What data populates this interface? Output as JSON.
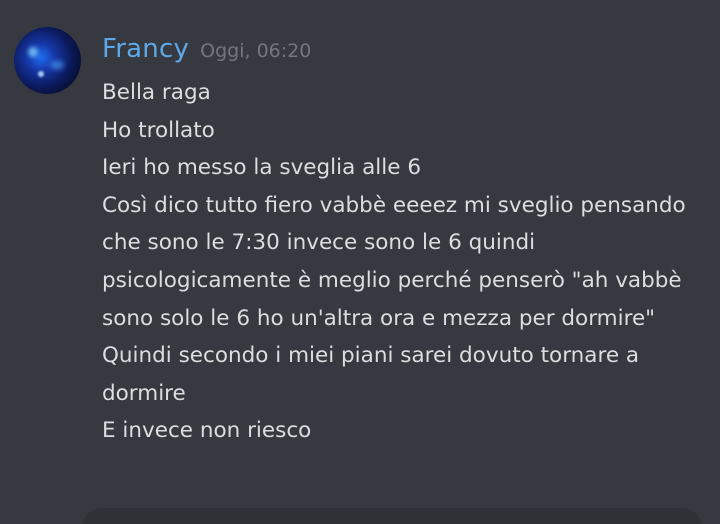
{
  "message": {
    "author": "Francy",
    "timestamp": "Oggi, 06:20",
    "author_color": "#5fa8e8",
    "avatar_icon": "avatar-galaxy-icon",
    "lines": [
      "Bella raga",
      "Ho trollato",
      "Ieri ho messo la sveglia alle 6",
      "Così dico tutto fiero vabbè eeeez mi sveglio pensando",
      "che sono le 7:30 invece sono le 6 quindi",
      "psicologicamente è meglio perché penserò \"ah vabbè",
      "sono solo le 6 ho un'altra ora e mezza per dormire\"",
      "Quindi secondo i miei piani sarei dovuto tornare a",
      "dormire",
      "E invece non riesco"
    ]
  },
  "colors": {
    "background": "#36393f",
    "text": "#dcddde",
    "timestamp": "#72767d",
    "composer": "#2f3136"
  }
}
